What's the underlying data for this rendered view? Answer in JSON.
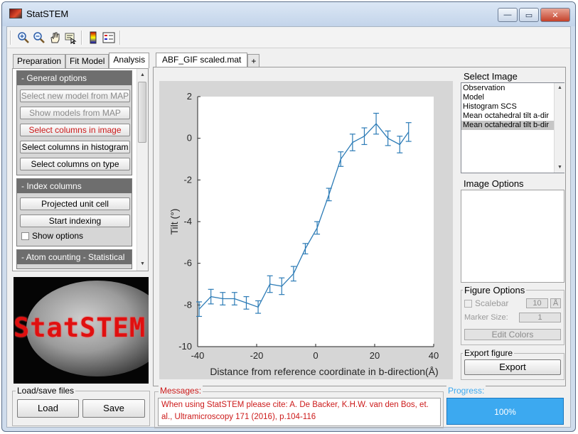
{
  "window": {
    "title": "StatSTEM",
    "minimize_glyph": "—",
    "restore_glyph": "▭",
    "close_glyph": "✕"
  },
  "toolbar": {
    "icons": [
      "zoom-in-icon",
      "zoom-out-icon",
      "pan-hand-icon",
      "data-cursor-icon",
      "colorbar-icon",
      "legend-icon"
    ]
  },
  "left_tabs": [
    {
      "label": "Preparation"
    },
    {
      "label": "Fit Model"
    },
    {
      "label": "Analysis"
    }
  ],
  "general_options": {
    "header": "- General options",
    "buttons": [
      "Select new model from MAP",
      "Show models from MAP",
      "Select columns in image",
      "Select columns in histogram",
      "Select columns on type"
    ]
  },
  "index_columns": {
    "header": "- Index columns",
    "buttons": [
      "Projected unit cell",
      "Start indexing"
    ],
    "checkbox_label": "Show options"
  },
  "atom_counting": {
    "header": "- Atom counting - Statistical"
  },
  "logo": {
    "text": "StatSTEM"
  },
  "load_save": {
    "title": "Load/save files",
    "load": "Load",
    "save": "Save"
  },
  "figure_tabs": [
    {
      "label": "ABF_GIF scaled.mat"
    },
    {
      "label": "+"
    }
  ],
  "chart_data": {
    "type": "line",
    "xlabel": "Distance from reference coordinate in b-direction(Å)",
    "ylabel": "Tilt (°)",
    "xlim": [
      -40,
      40
    ],
    "ylim": [
      -10,
      2
    ],
    "xticks": [
      -40,
      -20,
      0,
      20,
      40
    ],
    "yticks": [
      -10,
      -8,
      -6,
      -4,
      -2,
      0,
      2
    ],
    "grid": false,
    "color": "#2c7bb6",
    "x": [
      -39.5,
      -35.5,
      -31.5,
      -27.5,
      -23.5,
      -19.5,
      -15.5,
      -11.5,
      -7.5,
      -3.5,
      0.5,
      4.5,
      8.5,
      12.5,
      16.5,
      20.5,
      24.5,
      28.5,
      31.5
    ],
    "y": [
      -8.2,
      -7.6,
      -7.7,
      -7.7,
      -7.9,
      -8.1,
      -7.0,
      -7.1,
      -6.5,
      -5.3,
      -4.3,
      -2.7,
      -1.0,
      -0.2,
      0.1,
      0.7,
      0.0,
      -0.3,
      0.3
    ],
    "err": [
      0.35,
      0.35,
      0.3,
      0.3,
      0.3,
      0.3,
      0.4,
      0.4,
      0.35,
      0.25,
      0.3,
      0.3,
      0.35,
      0.4,
      0.4,
      0.5,
      0.35,
      0.4,
      0.45
    ]
  },
  "select_image": {
    "title": "Select Image",
    "items": [
      "Observation",
      "Model",
      "Histogram SCS",
      "Mean octahedral tilt a-dir",
      "Mean octahedral tilt b-dir"
    ],
    "selected_index": 4
  },
  "image_options": {
    "title": "Image Options"
  },
  "figure_options": {
    "title": "Figure Options",
    "scalebar_label": "Scalebar",
    "scalebar_value": "10",
    "scalebar_unit": "Å",
    "marker_label": "Marker Size:",
    "marker_value": "1",
    "edit_colors": "Edit Colors"
  },
  "export_figure": {
    "title": "Export figure",
    "button": "Export"
  },
  "messages": {
    "title": "Messages:",
    "text": "When using StatSTEM please cite: A. De Backer, K.H.W. van den Bos, et. al., Ultramicroscopy 171 (2016), p.104-116"
  },
  "progress": {
    "title": "Progress:",
    "value": "100%",
    "fraction": 1.0
  }
}
